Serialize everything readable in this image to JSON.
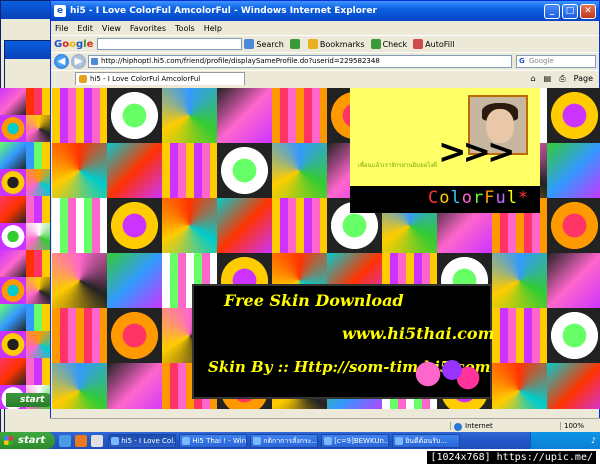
{
  "window": {
    "title": "hi5 - I Love ColorFul AmcolorFul - Windows Internet Explorer",
    "controls": [
      "_",
      "□",
      "✕"
    ]
  },
  "menu": [
    "File",
    "Edit",
    "View",
    "Favorites",
    "Tools",
    "Help"
  ],
  "google_toolbar": {
    "logo": [
      "G",
      "o",
      "o",
      "g",
      "l",
      "e"
    ],
    "search_label": "Search",
    "bookmarks_label": "Bookmarks",
    "check_label": "Check",
    "autofill_label": "AutoFill"
  },
  "address_bar": {
    "url": "http://hiphoptl.hi5.com/friend/profile/displaySameProfile.do?userid=229582348",
    "search_placeholder": "Google"
  },
  "tab": {
    "label": "hi5 - I Love ColorFul AmcolorFul",
    "page_label": "Page"
  },
  "page": {
    "thai_text": "เพื่อนแล้วเราจักรยานยิมยอไงดี",
    "arrows": ">>>",
    "colorful": [
      "C",
      "o",
      "l",
      "o",
      "r",
      "F",
      "u",
      "l",
      "*"
    ],
    "colorful_colors": [
      "#ff3333",
      "#ffcc00",
      "#33ccff",
      "#ff66cc",
      "#66ff33",
      "#ff9900",
      "#cc66ff",
      "#ffff00",
      "#ff3333"
    ],
    "banner_line1": "Free Skin Download",
    "banner_line2": "www.hi5thai.com",
    "banner_line3": "Skin By :: Http://som-tim.hi5.com"
  },
  "statusbar": {
    "zone": "Internet",
    "zoom": "100%"
  },
  "bg_window": {
    "start_label": "start"
  },
  "taskbar": {
    "start_label": "start",
    "tasks": [
      "hi5 - I Love Col...",
      "Hi5 Thai ! - Win...",
      "กติกาการสั่งกระ...",
      "[c=9]BEWKUn...",
      "ยินดีต้อนรับ..."
    ],
    "time": ""
  },
  "watermark": "[1024x768] https://upic.me/"
}
